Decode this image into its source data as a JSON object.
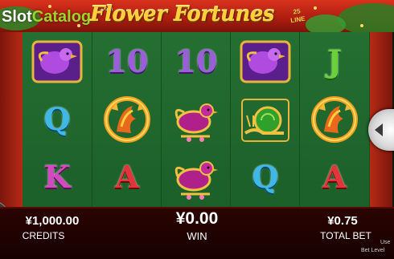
{
  "logo": {
    "main_a": "Slot",
    "main_b": "Catalog",
    "tld": ".com"
  },
  "header": {
    "game_title": "Flower Fortunes",
    "lines_number": "25",
    "lines_word": "LINE"
  },
  "reels": [
    [
      "bird-purple",
      "Q",
      "K"
    ],
    [
      "10",
      "phoenix-gold",
      "A"
    ],
    [
      "10",
      "hen-pink",
      "hen-pink"
    ],
    [
      "bird-purple",
      "snail-green",
      "Q"
    ],
    [
      "J",
      "phoenix-gold",
      "A"
    ]
  ],
  "status": {
    "credits_value": "¥1,000.00",
    "credits_label": "CREDITS",
    "win_value": "¥0.00",
    "win_label": "WIN",
    "total_bet_value": "¥0.75",
    "total_bet_label": "TOTAL BET",
    "use_text": "Use",
    "bet_level_text": "Bet Level"
  },
  "colors": {
    "banner": "#c4291a",
    "reel_bg": "#1f6a2e",
    "title_gold": "#ffcf3a",
    "bar_bg": "#1e0200"
  },
  "icons": [
    "spin-button-edge",
    "left-menu-edge"
  ]
}
